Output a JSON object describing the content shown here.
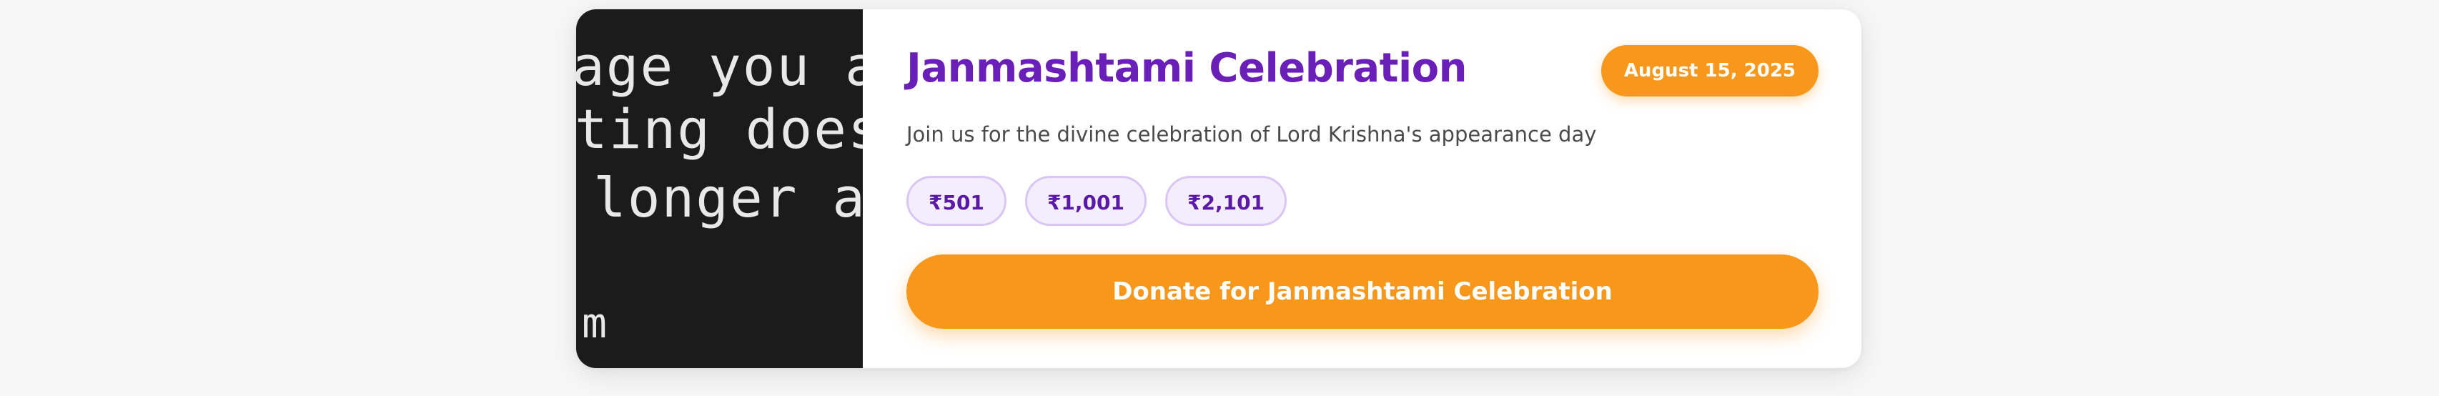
{
  "event": {
    "thumbnail_text": [
      "age you are",
      "ting does n",
      "longer ava",
      "m"
    ],
    "title": "Janmashtami Celebration",
    "date": "August 15, 2025",
    "description": "Join us for the divine celebration of Lord Krishna's appearance day",
    "amounts": [
      "₹501",
      "₹1,001",
      "₹2,101"
    ],
    "donate_label": "Donate for Janmashtami Celebration"
  },
  "colors": {
    "accent_orange": "#f7971c",
    "title_purple": "#6a1fb8",
    "chip_border": "#d9c6f4",
    "chip_background": "#f4eefc",
    "thumbnail_background": "#1b1b1b"
  }
}
